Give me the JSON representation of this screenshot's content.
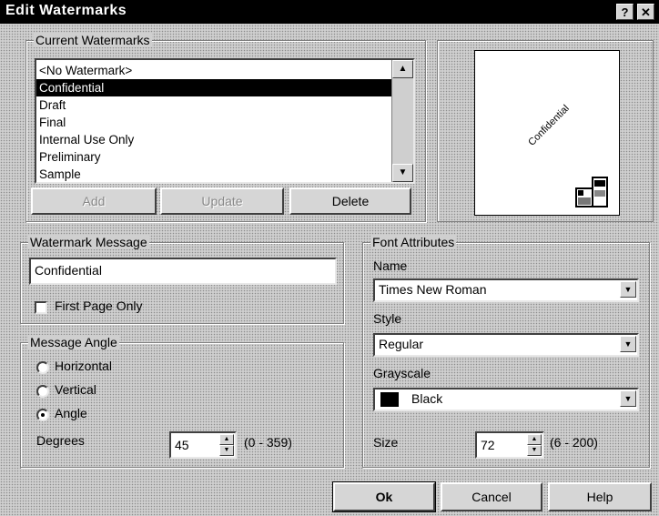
{
  "window": {
    "title": "Edit Watermarks",
    "help_glyph": "?",
    "close_glyph": "✕"
  },
  "current_watermarks": {
    "legend": "Current Watermarks",
    "items": [
      "<No Watermark>",
      "Confidential",
      "Draft",
      "Final",
      "Internal Use Only",
      "Preliminary",
      "Sample"
    ],
    "selected_index": 1,
    "add_label": "Add",
    "update_label": "Update",
    "delete_label": "Delete"
  },
  "preview": {
    "watermark_text": "Confidential",
    "rotation_degrees": 45
  },
  "watermark_message": {
    "legend": "Watermark Message",
    "value": "Confidential",
    "first_page_only_label": "First Page Only",
    "first_page_only_checked": false
  },
  "message_angle": {
    "legend": "Message Angle",
    "horizontal_label": "Horizontal",
    "vertical_label": "Vertical",
    "angle_label": "Angle",
    "selected": "Angle",
    "degrees_label": "Degrees",
    "degrees_value": "45",
    "degrees_range": "(0 - 359)"
  },
  "font_attributes": {
    "legend": "Font Attributes",
    "name_label": "Name",
    "name_value": "Times New Roman",
    "style_label": "Style",
    "style_value": "Regular",
    "grayscale_label": "Grayscale",
    "grayscale_value": "Black",
    "grayscale_color": "#000000",
    "size_label": "Size",
    "size_value": "72",
    "size_range": "(6 - 200)"
  },
  "footer": {
    "ok_label": "Ok",
    "cancel_label": "Cancel",
    "help_label": "Help"
  }
}
